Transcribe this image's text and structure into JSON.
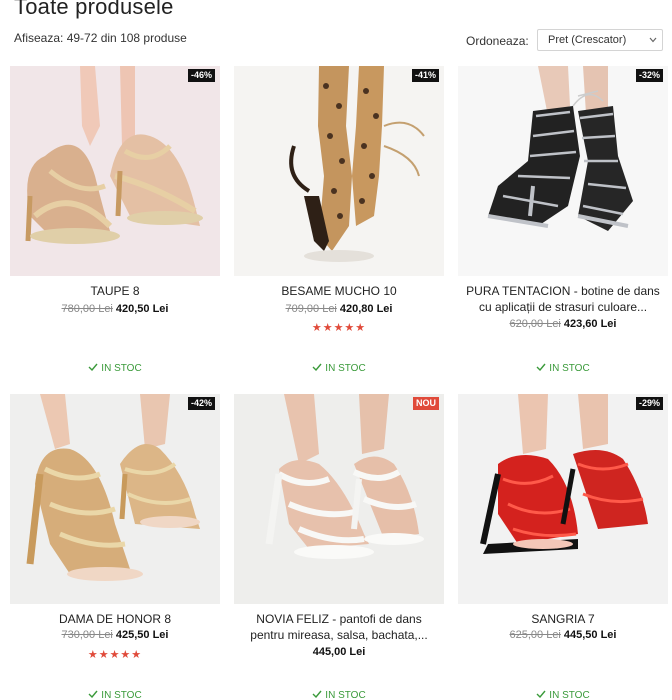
{
  "header": {
    "title": "Toate produsele",
    "results_text": "Afiseaza: 49-72 din 108 produse",
    "sort_label": "Ordoneaza:",
    "sort_value": "Pret (Crescator)"
  },
  "stock_label": "IN STOC",
  "products": [
    {
      "badge": "-46%",
      "title": "TAUPE 8",
      "old_price": "780,00 Lei",
      "price": "420,50 Lei",
      "stars": ""
    },
    {
      "badge": "-41%",
      "title": "BESAME MUCHO 10",
      "old_price": "709,00 Lei",
      "price": "420,80 Lei",
      "stars": "★★★★★"
    },
    {
      "badge": "-32%",
      "title_line1": "PURA TENTACION - botine de dans",
      "title_line2": "cu aplicații de strasuri culoare...",
      "old_price": "620,00 Lei",
      "price": "423,60 Lei",
      "stars": ""
    },
    {
      "badge": "-42%",
      "title": "DAMA DE HONOR 8",
      "old_price": "730,00 Lei",
      "price": "425,50 Lei",
      "stars": "★★★★★"
    },
    {
      "badge": "NOU",
      "title_line1": "NOVIA FELIZ - pantofi de dans",
      "title_line2": "pentru mireasa, salsa, bachata,...",
      "old_price": "",
      "price": "445,00 Lei",
      "stars": ""
    },
    {
      "badge": "-29%",
      "title": "SANGRIA 7",
      "old_price": "625,00 Lei",
      "price": "445,50 Lei",
      "stars": ""
    }
  ],
  "colors": {
    "stars": "#e04a3a",
    "stock": "#3a9a3a",
    "badge": "#111111",
    "badge_new": "#e04a3a"
  }
}
